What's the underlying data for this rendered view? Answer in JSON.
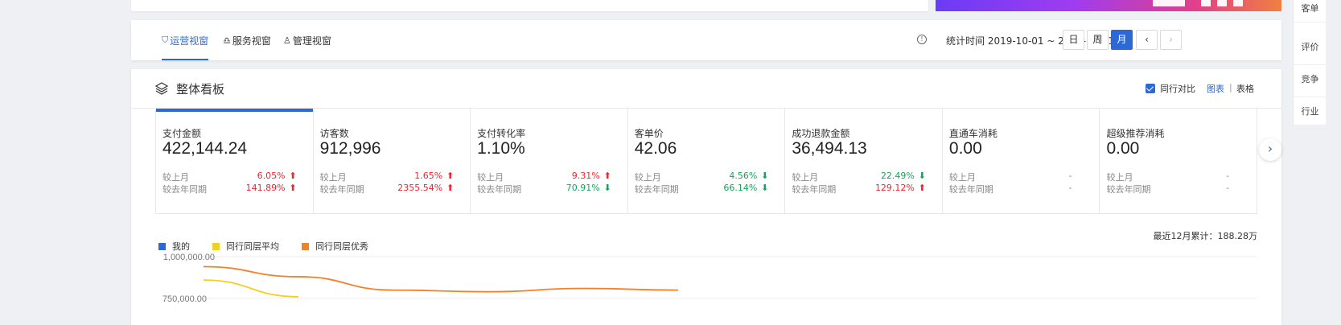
{
  "nav": {
    "tabs": [
      {
        "label": "运营视窗",
        "icon": "shield-icon"
      },
      {
        "label": "服务视窗",
        "icon": "headset-icon"
      },
      {
        "label": "管理视窗",
        "icon": "person-icon"
      }
    ],
    "stat_time": "统计时间 2019-10-01 ~ 2019-10-31",
    "period_buttons": [
      "日",
      "周",
      "月"
    ],
    "active_period": "月",
    "prev_label": "‹",
    "next_label": "›"
  },
  "board": {
    "title": "整体看板",
    "peer_compare_label": "同行对比",
    "view_chart": "图表",
    "view_sep": "|",
    "view_table": "表格"
  },
  "metrics": [
    {
      "name": "支付金额",
      "value": "422,144.24",
      "mom_label": "较上月",
      "mom": "6.05%",
      "mom_dir": "up",
      "yoy_label": "较去年同期",
      "yoy": "141.89%",
      "yoy_dir": "up"
    },
    {
      "name": "访客数",
      "value": "912,996",
      "mom_label": "较上月",
      "mom": "1.65%",
      "mom_dir": "up",
      "yoy_label": "较去年同期",
      "yoy": "2355.54%",
      "yoy_dir": "up"
    },
    {
      "name": "支付转化率",
      "value": "1.10%",
      "mom_label": "较上月",
      "mom": "9.31%",
      "mom_dir": "up",
      "yoy_label": "较去年同期",
      "yoy": "70.91%",
      "yoy_dir": "down"
    },
    {
      "name": "客单价",
      "value": "42.06",
      "mom_label": "较上月",
      "mom": "4.56%",
      "mom_dir": "down",
      "yoy_label": "较去年同期",
      "yoy": "66.14%",
      "yoy_dir": "down"
    },
    {
      "name": "成功退款金额",
      "value": "36,494.13",
      "mom_label": "较上月",
      "mom": "22.49%",
      "mom_dir": "down",
      "yoy_label": "较去年同期",
      "yoy": "129.12%",
      "yoy_dir": "up"
    },
    {
      "name": "直通车消耗",
      "value": "0.00",
      "mom_label": "较上月",
      "mom": "-",
      "mom_dir": "none",
      "yoy_label": "较去年同期",
      "yoy": "-",
      "yoy_dir": "none"
    },
    {
      "name": "超级推荐消耗",
      "value": "0.00",
      "mom_label": "较上月",
      "mom": "-",
      "mom_dir": "none",
      "yoy_label": "较去年同期",
      "yoy": "-",
      "yoy_dir": "none"
    }
  ],
  "chart": {
    "cumulative": "最近12月累计：188.28万",
    "legend": [
      {
        "name": "我的",
        "color": "#2c68d6"
      },
      {
        "name": "同行同层平均",
        "color": "#f0d020"
      },
      {
        "name": "同行同层优秀",
        "color": "#f5802a"
      }
    ],
    "y_ticks": [
      "1,000,000.00",
      "750,000.00"
    ]
  },
  "chart_data": {
    "type": "line",
    "title": "",
    "xlabel": "",
    "ylabel": "",
    "y_ticks": [
      1000000,
      750000
    ],
    "series": [
      {
        "name": "我的",
        "values": []
      },
      {
        "name": "同行同层平均",
        "values": [
          860000,
          760000
        ]
      },
      {
        "name": "同行同层优秀",
        "values": [
          940000,
          880000,
          800000,
          790000,
          810000,
          800000
        ]
      }
    ]
  },
  "side": {
    "items": [
      "客单",
      "评价",
      "竞争",
      "行业"
    ]
  },
  "colors": {
    "accent": "#2c68d6",
    "up": "#f5222d",
    "down": "#13a55a"
  }
}
